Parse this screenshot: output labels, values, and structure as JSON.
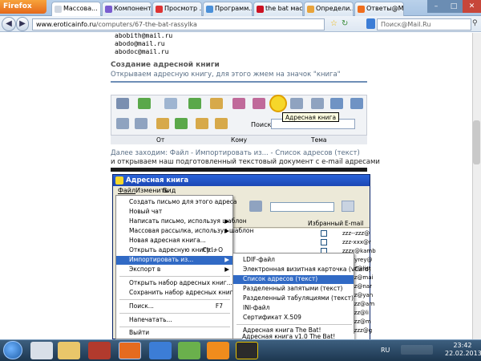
{
  "browser": {
    "firefox_label": "Firefox",
    "tabs": [
      {
        "label": "Массова...",
        "color": "#cfd6e0",
        "active": true
      },
      {
        "label": "Компонент...",
        "color": "#7a5ccf"
      },
      {
        "label": "Просмотр ...",
        "color": "#d33"
      },
      {
        "label": "Программ...",
        "color": "#4a90d9"
      },
      {
        "label": "the bat мас...",
        "color": "#c12"
      },
      {
        "label": "Определи...",
        "color": "#e8a33a"
      },
      {
        "label": "Ответы@M...",
        "color": "#f06e1d"
      }
    ],
    "url_prefix": "www.eroticainfo.ru",
    "url_path": "/computers/67-the-bat-rassylka",
    "search_placeholder": "Поиск@Mail.Ru",
    "win_min": "–",
    "win_max": "□",
    "win_close": "✕"
  },
  "article": {
    "emails": [
      "abobith@mail.ru",
      "abodo@mail.ru",
      "abodoc@mail.ru"
    ],
    "heading": "Создание адресной книги",
    "subtitle": "Открываем адресную книгу, для этого жмем на значок \"книга\"",
    "tooltip": "Адресная книга",
    "search_label": "Поиск:",
    "col_from": "От",
    "col_to": "Кому",
    "col_subject": "Тема",
    "para1": "Далее заходим: Файл - Импортировать из... - Список адресов (текст)",
    "para2": "и открываем наш подготовленный текстовый документ с e-mail адресами"
  },
  "addressbook": {
    "title": "Адресная книга",
    "menus": [
      "Файл",
      "Изменить",
      "Вид"
    ],
    "col_fav": "Избранный",
    "col_email": "E-mail",
    "emails": [
      "zzz--zzz@",
      "zzz-xxx@r",
      "zzzx@kamb",
      "zzzyyrey@",
      "zzzzz@list",
      "zzzzz@mai",
      "zzzzz@nar",
      "zzzzz@yan",
      "zzzzzz@am",
      "zzzzzz@li",
      "zzzzzz@m",
      "zzzzzzz@g"
    ]
  },
  "menu_file": {
    "items": [
      {
        "label": "Создать письмо для этого адреса"
      },
      {
        "label": "Новый чат"
      },
      {
        "label": "Написать письмо, используя шаблон",
        "arrow": "▶"
      },
      {
        "label": "Массовая рассылка, используя шаблон",
        "arrow": "▶"
      },
      {
        "label": "Новая адресная книга..."
      },
      {
        "label": "Открыть адресную книгу...",
        "key": "Ctrl+O"
      },
      {
        "label": "Импортировать из...",
        "arrow": "▶"
      },
      {
        "label": "Экспорт в",
        "arrow": "▶"
      },
      {
        "label": "Открыть набор адресных книг..."
      },
      {
        "label": "Сохранить набор адресных книг..."
      },
      {
        "label": "Поиск...",
        "key": "F7"
      },
      {
        "label": "Напечатать..."
      },
      {
        "label": "Выйти"
      }
    ]
  },
  "menu_import": {
    "items": [
      "LDIF-файл",
      "Электронная визитная карточка (vCard)",
      "Список адресов (текст)",
      "Разделенный запятыми (текст)",
      "Разделенный табуляциями (текст)",
      "INI-файл",
      "Сертификат X.509",
      "Адресная книга The Bat!",
      "Адресная книга v1.0 The Bat!"
    ]
  },
  "taskbar": {
    "lang": "RU",
    "time": "23:42",
    "date": "22.02.2013"
  }
}
